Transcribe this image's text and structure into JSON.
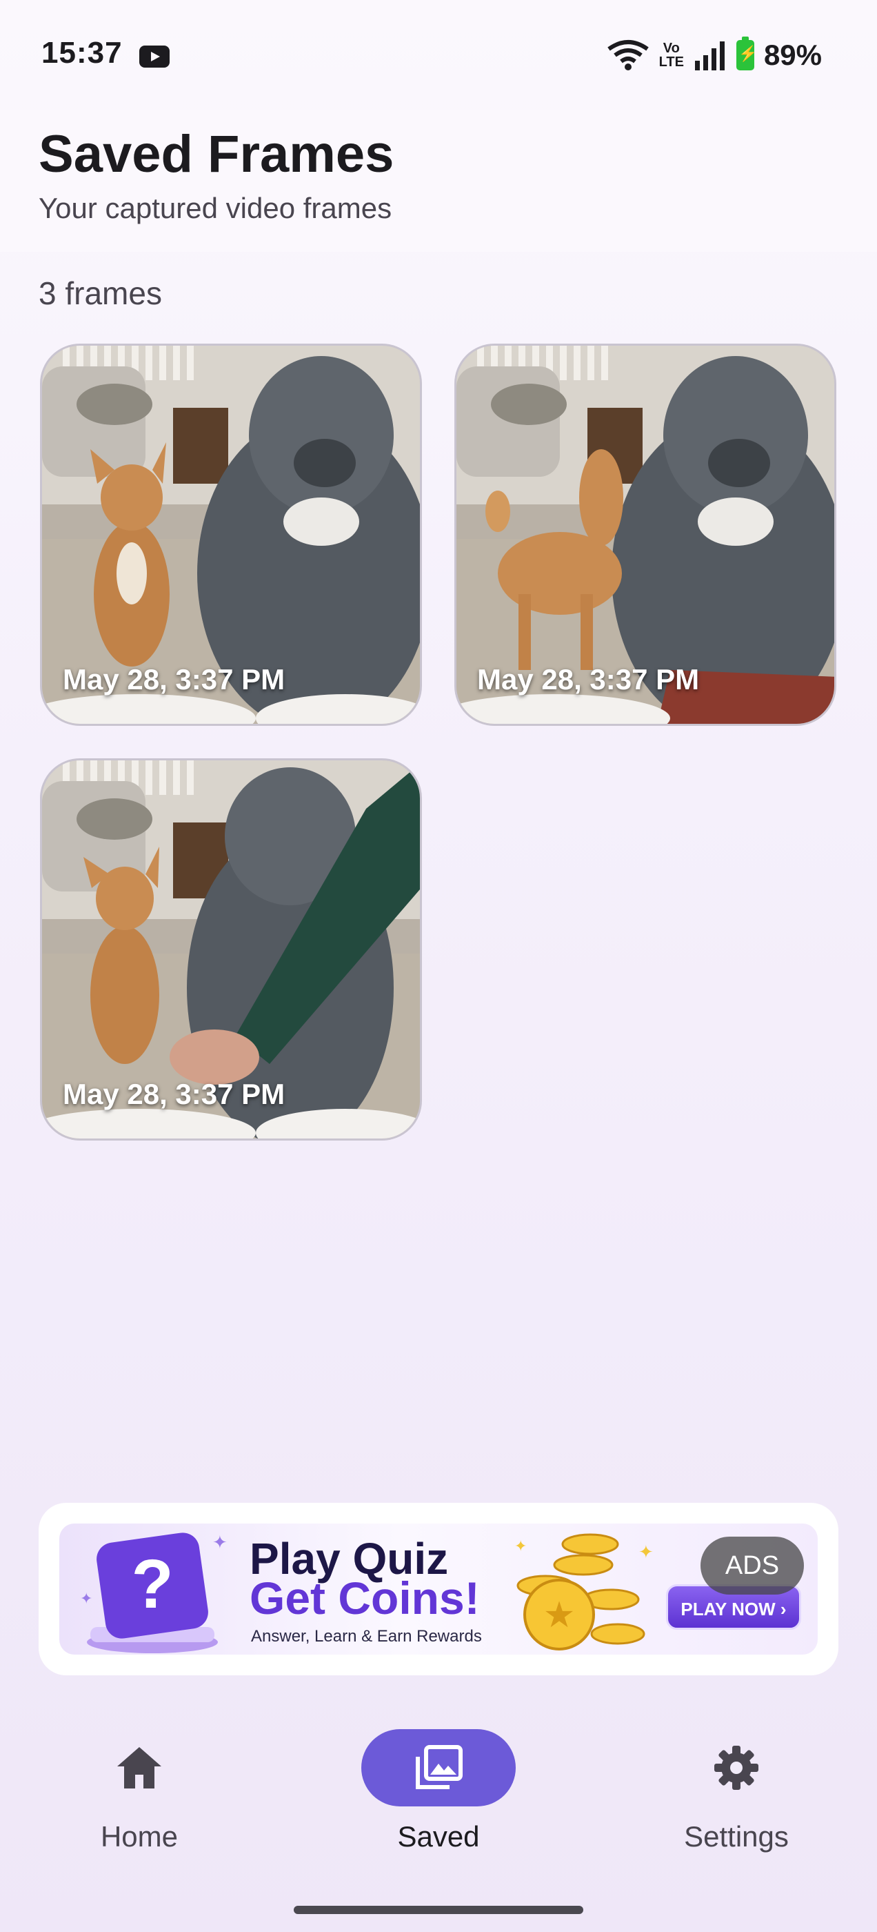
{
  "status_bar": {
    "time": "15:37",
    "volte_line1": "Vo",
    "volte_line2": "LTE",
    "battery": "89%",
    "icons": [
      "youtube-icon",
      "wifi-icon",
      "volte-icon",
      "signal-icon",
      "battery-charging-icon"
    ]
  },
  "header": {
    "title": "Saved Frames",
    "subtitle": "Your captured video frames"
  },
  "frames": {
    "count_label": "3 frames",
    "items": [
      {
        "date": "May 28, 3:37 PM"
      },
      {
        "date": "May 28, 3:37 PM"
      },
      {
        "date": "May 28, 3:37 PM"
      }
    ]
  },
  "ad": {
    "headline1": "Play Quiz",
    "headline2": "Get Coins!",
    "tagline": "Answer, Learn & Earn Rewards",
    "cta": "PLAY NOW ›",
    "badge": "ADS"
  },
  "nav": {
    "items": [
      {
        "label": "Home",
        "icon": "home-icon",
        "active": false
      },
      {
        "label": "Saved",
        "icon": "gallery-icon",
        "active": true
      },
      {
        "label": "Settings",
        "icon": "gear-icon",
        "active": false
      }
    ]
  },
  "colors": {
    "accent": "#6c5ad8",
    "background": "#f5f0fb",
    "ad_purple": "#6236d6"
  }
}
